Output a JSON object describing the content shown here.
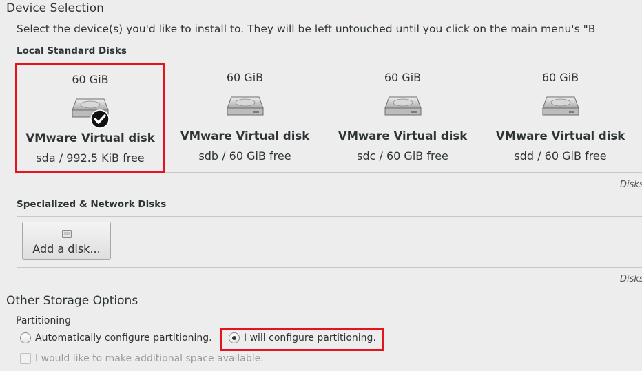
{
  "device_selection": {
    "title": "Device Selection",
    "intro": "Select the device(s) you'd like to install to.  They will be left untouched until you click on the main menu's \"B"
  },
  "local_disks": {
    "label": "Local Standard Disks",
    "disks": [
      {
        "size": "60 GiB",
        "name": "VMware Virtual disk",
        "free": "sda  /  992.5 KiB free",
        "selected": true
      },
      {
        "size": "60 GiB",
        "name": "VMware Virtual disk",
        "free": "sdb   /   60 GiB free",
        "selected": false
      },
      {
        "size": "60 GiB",
        "name": "VMware Virtual disk",
        "free": "sdc   /   60 GiB free",
        "selected": false
      },
      {
        "size": "60 GiB",
        "name": "VMware Virtual disk",
        "free": "sdd   /   60 GiB free",
        "selected": false
      }
    ],
    "note": "Disks"
  },
  "network_disks": {
    "label": "Specialized & Network Disks",
    "add_button_label": "Add a disk...",
    "note": "Disks"
  },
  "other_storage": {
    "title": "Other Storage Options",
    "partitioning_label": "Partitioning",
    "auto_option": "Automatically configure partitioning.",
    "manual_option": "I will configure partitioning.",
    "selected_option": "I will configure partitioning.",
    "extra_space_option": "I would like to make additional space available.",
    "extra_space_checked": false,
    "extra_space_enabled": false
  },
  "colors": {
    "highlight": "#e5131d",
    "background": "#ededed",
    "text": "#2e3436"
  },
  "icons": {
    "disk": "hard-disk-icon",
    "selected": "checkmark-icon",
    "add_disk": "disk-add-icon"
  }
}
